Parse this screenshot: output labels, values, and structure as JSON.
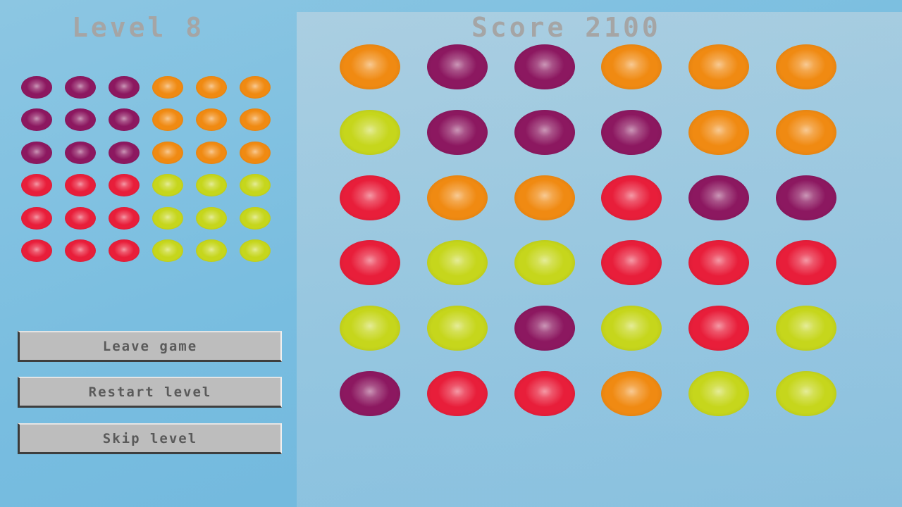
{
  "header": {
    "level_label": "Level 8",
    "score_label": "Score 2100"
  },
  "buttons": {
    "leave": "Leave game",
    "restart": "Restart level",
    "skip": "Skip level"
  },
  "colors": {
    "P": "#8c1860",
    "O": "#f08a12",
    "R": "#e81e3a",
    "Y": "#c6d61c"
  },
  "target_pattern": [
    [
      "P",
      "P",
      "P",
      "O",
      "O",
      "O"
    ],
    [
      "P",
      "P",
      "P",
      "O",
      "O",
      "O"
    ],
    [
      "P",
      "P",
      "P",
      "O",
      "O",
      "O"
    ],
    [
      "R",
      "R",
      "R",
      "Y",
      "Y",
      "Y"
    ],
    [
      "R",
      "R",
      "R",
      "Y",
      "Y",
      "Y"
    ],
    [
      "R",
      "R",
      "R",
      "Y",
      "Y",
      "Y"
    ]
  ],
  "board": [
    [
      "O",
      "P",
      "P",
      "O",
      "O",
      "O"
    ],
    [
      "Y",
      "P",
      "P",
      "P",
      "O",
      "O"
    ],
    [
      "R",
      "O",
      "O",
      "R",
      "P",
      "P"
    ],
    [
      "R",
      "Y",
      "Y",
      "R",
      "R",
      "R"
    ],
    [
      "Y",
      "Y",
      "P",
      "Y",
      "R",
      "Y"
    ],
    [
      "P",
      "R",
      "R",
      "O",
      "Y",
      "Y"
    ]
  ],
  "gem_names": {
    "P": "purple",
    "O": "orange",
    "R": "red",
    "Y": "yellow"
  }
}
